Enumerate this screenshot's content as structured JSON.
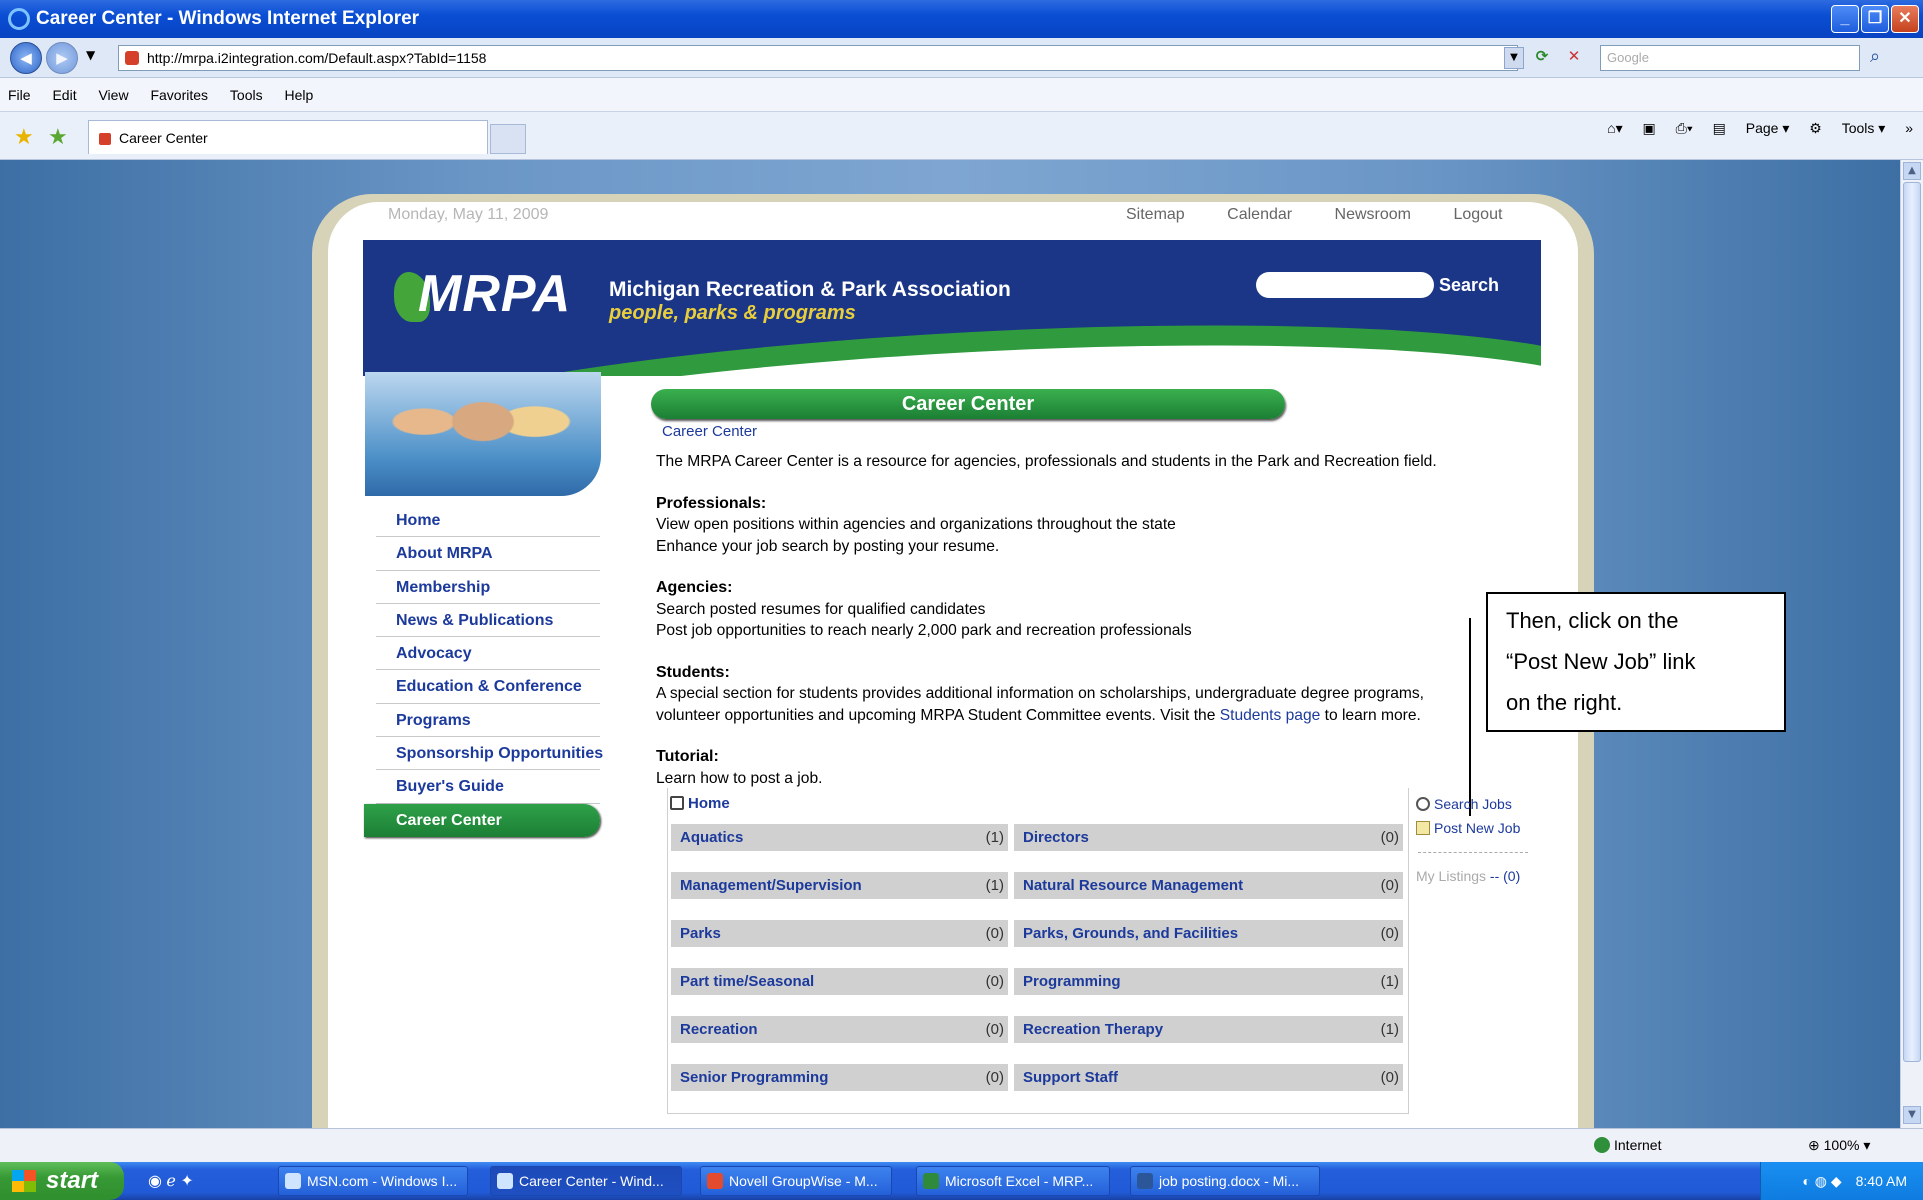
{
  "window": {
    "title": "Career Center - Windows Internet Explorer",
    "url": "http://mrpa.i2integration.com/Default.aspx?TabId=1158",
    "search_placeholder": "Google",
    "menu": [
      "File",
      "Edit",
      "View",
      "Favorites",
      "Tools",
      "Help"
    ],
    "tab_title": "Career Center",
    "commands": [
      "Page",
      "Tools"
    ]
  },
  "page": {
    "date": "Monday, May 11, 2009",
    "top_links": [
      "Sitemap",
      "Calendar",
      "Newsroom",
      "Logout"
    ],
    "logo": "MRPA",
    "org_name": "Michigan Recreation & Park Association",
    "tagline": "people, parks & programs",
    "search_label": "Search",
    "nav": [
      {
        "label": "Home",
        "active": false
      },
      {
        "label": "About MRPA",
        "active": false
      },
      {
        "label": "Membership",
        "active": false
      },
      {
        "label": "News & Publications",
        "active": false
      },
      {
        "label": "Advocacy",
        "active": false
      },
      {
        "label": "Education & Conference",
        "active": false
      },
      {
        "label": "Programs",
        "active": false
      },
      {
        "label": "Sponsorship Opportunities",
        "active": false
      },
      {
        "label": "Buyer's Guide",
        "active": false
      },
      {
        "label": "Career Center",
        "active": true
      }
    ],
    "section_title": "Career Center",
    "breadcrumb": "Career Center",
    "intro": "The MRPA Career Center is a resource for agencies, professionals and students in the Park and Recreation field.",
    "professionals": {
      "heading": "Professionals:",
      "lines": [
        "View open positions within agencies and organizations throughout the state",
        "Enhance your job search by posting your resume."
      ]
    },
    "agencies": {
      "heading": "Agencies:",
      "lines": [
        "Search posted resumes for qualified candidates",
        "Post job opportunities to reach nearly 2,000 park and recreation professionals"
      ]
    },
    "students": {
      "heading": "Students:",
      "line1": "A special section for students provides additional information on scholarships, undergraduate degree programs,",
      "line2_pre": "volunteer opportunities and upcoming MRPA Student Committee events. Visit the ",
      "line2_link": "Students page",
      "line2_post": " to learn more."
    },
    "tutorial": {
      "heading": "Tutorial:",
      "line": "Learn how to post a job."
    },
    "jobs_home": "Home",
    "job_categories": [
      {
        "name": "Aquatics",
        "count": "(1)"
      },
      {
        "name": "Directors",
        "count": "(0)"
      },
      {
        "name": "Management/Supervision",
        "count": "(1)"
      },
      {
        "name": "Natural Resource Management",
        "count": "(0)"
      },
      {
        "name": "Parks",
        "count": "(0)"
      },
      {
        "name": "Parks, Grounds, and Facilities",
        "count": "(0)"
      },
      {
        "name": "Part time/Seasonal",
        "count": "(0)"
      },
      {
        "name": "Programming",
        "count": "(1)"
      },
      {
        "name": "Recreation",
        "count": "(0)"
      },
      {
        "name": "Recreation Therapy",
        "count": "(1)"
      },
      {
        "name": "Senior Programming",
        "count": "(0)"
      },
      {
        "name": "Support Staff",
        "count": "(0)"
      }
    ],
    "side_links": {
      "search_jobs": "Search Jobs",
      "post_new_job": "Post New Job",
      "my_listings": "My Listings",
      "my_listings_count": "-- (0)"
    }
  },
  "callout": {
    "line1": "Then, click on the",
    "line2": "“Post New Job” link",
    "line3": "on the right."
  },
  "status": {
    "zone": "Internet",
    "zoom": "100%"
  },
  "taskbar": {
    "start": "start",
    "tasks": [
      {
        "label": "MSN.com - Windows I...",
        "active": false
      },
      {
        "label": "Career Center - Wind...",
        "active": true
      },
      {
        "label": "Novell GroupWise - M...",
        "active": false
      },
      {
        "label": "Microsoft Excel - MRP...",
        "active": false
      },
      {
        "label": "job posting.docx - Mi...",
        "active": false
      }
    ],
    "clock": "8:40 AM"
  }
}
